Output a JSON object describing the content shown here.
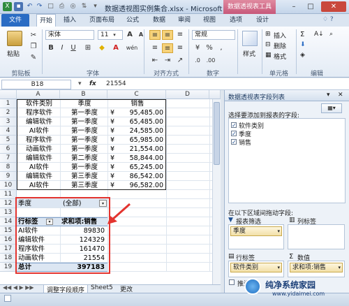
{
  "window": {
    "title": "数据透视图实例集合.xlsx - Microsoft Excel",
    "context_tab": "数据透视表工具"
  },
  "tabs": [
    "文件",
    "开始",
    "插入",
    "页面布局",
    "公式",
    "数据",
    "审阅",
    "视图",
    "选项",
    "设计"
  ],
  "ribbon": {
    "paste_label": "粘贴",
    "font_name": "宋体",
    "font_size": "11",
    "number_format": "常规",
    "bold": "B",
    "italic": "I",
    "underline": "U",
    "grow_font": "A",
    "shrink_font": "A",
    "wen": "wén",
    "percent": "%",
    "comma": ",",
    "incr_decimal": ".0",
    "style_label": "样式",
    "insert_label": "插入",
    "delete_label": "删除",
    "format_label": "格式",
    "sum_symbol": "Σ",
    "groups": [
      "剪贴板",
      "字体",
      "对齐方式",
      "数字",
      "单元格",
      "编辑"
    ]
  },
  "formula_bar": {
    "name_box": "B18",
    "fx": "fx",
    "value": "21554"
  },
  "columns": [
    "A",
    "B",
    "C",
    "D"
  ],
  "rows": [
    "1",
    "2",
    "3",
    "4",
    "5",
    "6",
    "7",
    "8",
    "9",
    "10",
    "11",
    "12",
    "13",
    "14",
    "15",
    "16",
    "17",
    "18",
    "19"
  ],
  "source_table": {
    "headers": [
      "软件类别",
      "季度",
      "销售"
    ],
    "rows": [
      [
        "程序软件",
        "第一季度",
        "¥",
        "95,485.00"
      ],
      [
        "编辑软件",
        "第一季度",
        "¥",
        "65,485.00"
      ],
      [
        "AI软件",
        "第一季度",
        "¥",
        "24,585.00"
      ],
      [
        "程序软件",
        "第一季度",
        "¥",
        "65,985.00"
      ],
      [
        "动画软件",
        "第一季度",
        "¥",
        "21,554.00"
      ],
      [
        "编辑软件",
        "第二季度",
        "¥",
        "58,844.00"
      ],
      [
        "AI软件",
        "第一季度",
        "¥",
        "65,245.00"
      ],
      [
        "编辑软件",
        "第三季度",
        "¥",
        "86,542.00"
      ],
      [
        "AI软件",
        "第三季度",
        "¥",
        "96,582.00"
      ]
    ]
  },
  "pivot": {
    "filter_label": "季度",
    "filter_value": "(全部)",
    "row_header": "行标签",
    "value_header": "求和项:销售",
    "rows": [
      {
        "label": "AI软件",
        "value": "89830"
      },
      {
        "label": "编辑软件",
        "value": "124329"
      },
      {
        "label": "程序软件",
        "value": "161470"
      },
      {
        "label": "动画软件",
        "value": "21554"
      }
    ],
    "total_label": "总计",
    "total_value": "397183"
  },
  "sheet_tabs": {
    "tab1": "调整字段顺序",
    "tab2": "Sheet5",
    "tab3": "更改"
  },
  "pane": {
    "title": "数据透视表字段列表",
    "choose_label": "选择要添加到报表的字段:",
    "fields": [
      {
        "name": "软件类别",
        "checked": true
      },
      {
        "name": "季度",
        "checked": true
      },
      {
        "name": "销售",
        "checked": true
      }
    ],
    "drag_label": "在以下区域间拖动字段:",
    "report_filter": "报表筛选",
    "column_labels": "列标签",
    "row_labels": "行标签",
    "values": "数值",
    "filter_item": "季度",
    "row_item": "软件类别",
    "value_item": "求和项:销售",
    "defer_label": "推迟",
    "values_symbol": "Σ"
  },
  "watermark": {
    "title": "纯净系统家园",
    "url": "www.yidaimei.com"
  },
  "colors": {
    "accent": "#2a6cc4",
    "pivot_tab": "#c7587a",
    "highlight": "#e3342f"
  }
}
